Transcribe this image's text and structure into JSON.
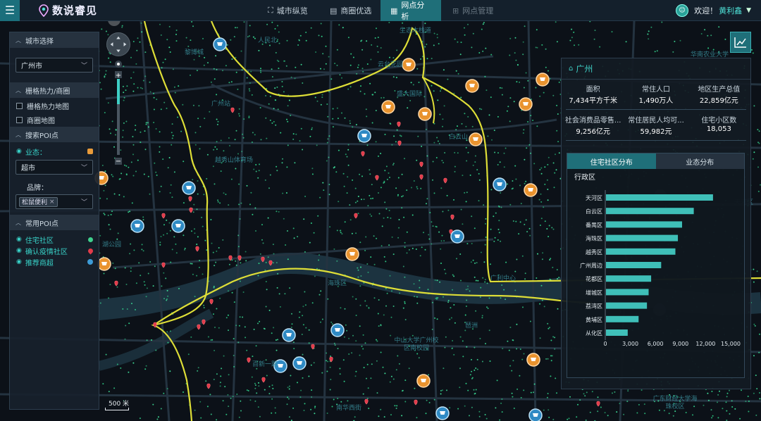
{
  "app": {
    "logo_text": "数说睿见"
  },
  "nav": [
    {
      "label": "城市纵览",
      "icon": "city-overview-icon",
      "state": "normal"
    },
    {
      "label": "商圈优选",
      "icon": "business-district-icon",
      "state": "normal"
    },
    {
      "label": "网点分析",
      "icon": "outlet-analysis-icon",
      "state": "active"
    },
    {
      "label": "网点管理",
      "icon": "outlet-manage-icon",
      "state": "disabled"
    }
  ],
  "user": {
    "greeting": "欢迎！",
    "name": "黄利鑫"
  },
  "left_panel": {
    "city_section": {
      "title": "城市选择",
      "selected_city": "广州市"
    },
    "grid_section": {
      "title": "栅格热力/商圈",
      "options": [
        "栅格热力地图",
        "商圈地图"
      ]
    },
    "poi_search": {
      "title": "搜索POI点",
      "business_label": "业态：",
      "business_value": "超市",
      "brand_label": "品牌：",
      "brand_tag": "松鼠便利"
    },
    "common_poi": {
      "title": "常用POI点",
      "items": [
        {
          "label": "住宅社区",
          "legend_color": "#3fd18d"
        },
        {
          "label": "确认疫情社区",
          "legend_color": "#e23b4a"
        },
        {
          "label": "推荐商超",
          "legend_color": "#3d9bd6"
        }
      ]
    }
  },
  "map": {
    "scale_label": "500 米",
    "place_labels": [
      "生态木栈道",
      "华南农业大学",
      "黎博城",
      "广州站",
      "越秀山体育场",
      "云台花园",
      "盛大国际",
      "白云山",
      "海珠区",
      "琶洲",
      "中山大学广州校区南校园",
      "广东财经大学海珠校区",
      "南华西街",
      "湖公园",
      "百新一路",
      "人民北",
      "广利中心",
      "天河区"
    ]
  },
  "right_panel": {
    "city": "广州",
    "stats_row1": [
      {
        "label": "面积",
        "value": "7,434平方千米"
      },
      {
        "label": "常住人口",
        "value": "1,490万人"
      },
      {
        "label": "地区生产总值",
        "value": "22,859亿元"
      }
    ],
    "stats_row2": [
      {
        "label": "社会消费品零售...",
        "value": "9,256亿元"
      },
      {
        "label": "常住居民人均可...",
        "value": "59,982元"
      },
      {
        "label": "住宅小区数",
        "value": "18,053"
      }
    ],
    "tabs": [
      {
        "label": "住宅社区分布",
        "active": true
      },
      {
        "label": "业态分布",
        "active": false
      }
    ],
    "chart_heading": "行政区"
  },
  "colors": {
    "accent": "#1f6f79",
    "teal_text": "#3ecfc5",
    "bar": "#3fbfb8"
  },
  "chart_data": {
    "type": "bar",
    "orientation": "horizontal",
    "categories": [
      "天河区",
      "白云区",
      "番禺区",
      "海珠区",
      "越秀区",
      "广州周边",
      "花都区",
      "增城区",
      "荔湾区",
      "黄埔区",
      "从化区"
    ],
    "values": [
      12800,
      10500,
      9100,
      8600,
      8300,
      6600,
      5400,
      5100,
      4900,
      3900,
      2600
    ],
    "ylabel": "行政区",
    "xlim": [
      0,
      15000
    ],
    "xticks": [
      "0",
      "3,000",
      "6,000",
      "9,000",
      "12,000",
      "15,000"
    ],
    "grid": false
  }
}
